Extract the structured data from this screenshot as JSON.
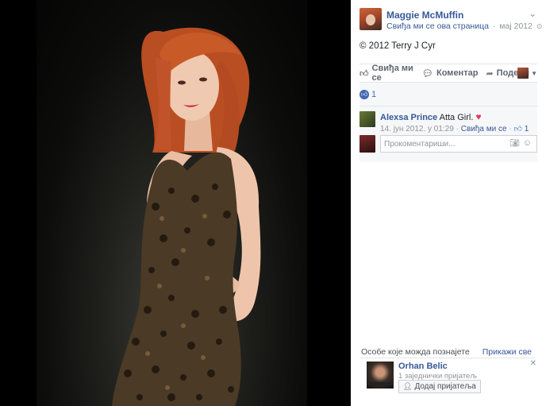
{
  "post": {
    "author": "Maggie McMuffin",
    "like_page": "Свиђа ми се ова страница",
    "date": "мај 2012",
    "caption": "© 2012 Terry J Cyr"
  },
  "actions": {
    "like": "Свиђа ми се",
    "comment": "Коментар",
    "share": "Подели"
  },
  "reactions": {
    "count": "1"
  },
  "comments": [
    {
      "name": "Alexsa Prince",
      "text": "Atta Girl.",
      "date": "14. јун 2012. у 01:29",
      "like": "Свиђа ми се",
      "likes": "1"
    }
  ],
  "compose": {
    "placeholder": "Прокоментариши..."
  },
  "pymk": {
    "title": "Особе које можда познајете",
    "see_all": "Прикажи све",
    "person": {
      "name": "Orhan Belic",
      "mutual": "1 заједнички пријатељ",
      "add": "Додај пријатеља"
    }
  },
  "colors": {
    "link": "#365899",
    "accent": "#4267b2",
    "heart": "#e0395b"
  }
}
